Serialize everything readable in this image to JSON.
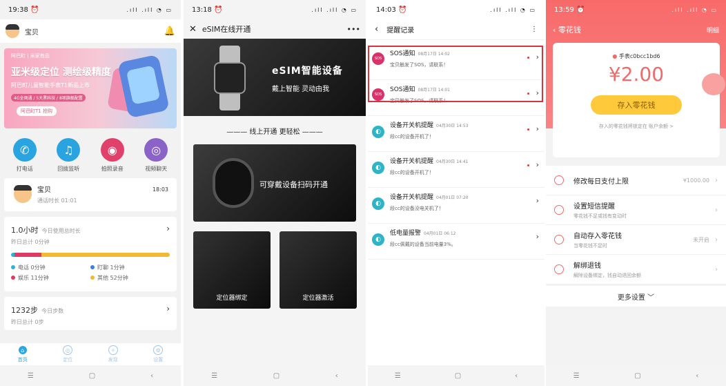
{
  "p1": {
    "time": "19:38 ⏰",
    "name": "宝贝",
    "banner": {
      "logo": "阿巴町 | 米家有品",
      "t1": "亚米级定位 测绘级精度",
      "t2": "阿巴町儿童智能手表T1新品上市",
      "t3": "4G全网通 / 5大黑科技 / 8项旗舰配置",
      "pill": "阿巴町T1 抢购"
    },
    "quick": [
      {
        "label": "打电话",
        "color": "#2aa4e0",
        "icon": "phone-icon",
        "glyph": "✆"
      },
      {
        "label": "回拨监听",
        "color": "#2aa4e0",
        "icon": "headphones-icon",
        "glyph": "♫"
      },
      {
        "label": "拍照录音",
        "color": "#e0406a",
        "icon": "camera-icon",
        "glyph": "◉"
      },
      {
        "label": "视频聊天",
        "color": "#8a62c8",
        "icon": "video-icon",
        "glyph": "◎"
      }
    ],
    "call": {
      "name": "宝贝",
      "time": "18:03",
      "sub": "通话时长 01:01"
    },
    "usage": {
      "big": "1.0小时",
      "small": "今日使用总时长",
      "sub": "昨日总计 0分钟",
      "segments": [
        {
          "color": "#2bb4d8",
          "frac": 0.02
        },
        {
          "color": "#e03a64",
          "frac": 0.17
        },
        {
          "color": "#f2b933",
          "frac": 0.81
        }
      ],
      "legend": [
        {
          "label": "电话 0分钟",
          "color": "#2bb4d8"
        },
        {
          "label": "盯聊 1分钟",
          "color": "#3b7de0"
        },
        {
          "label": "娱乐 11分钟",
          "color": "#e03a64"
        },
        {
          "label": "其他 52分钟",
          "color": "#f2b933"
        }
      ]
    },
    "steps": {
      "big": "1232步",
      "small": "今日步数",
      "sub": "昨日总计 0步"
    },
    "tabs": [
      "首页",
      "定位",
      "发现",
      "设置"
    ]
  },
  "p2": {
    "time": "13:18 ⏰",
    "title": "eSIM在线开通",
    "h1": "eSIM智能设备",
    "h2": "戴上智能 灵动由我",
    "div": "线上开通 更轻松",
    "scan": "可穿戴设备扫码开通",
    "b1": "定位器绑定",
    "b2": "定位器激活"
  },
  "p3": {
    "time": "14:03 ⏰",
    "title": "提醒记录",
    "rows": [
      {
        "t": "SOS通知",
        "tm": "08月17日 14:02",
        "m": "宝贝触发了SOS，请联系！",
        "type": "sos",
        "red": true
      },
      {
        "t": "SOS通知",
        "tm": "08月17日 14:01",
        "m": "宝贝触发了SOS，请联系！",
        "type": "sos",
        "red": true
      },
      {
        "t": "设备开关机提醒",
        "tm": "04月30日 14:53",
        "m": "段cc的设备开机了！",
        "type": "dev",
        "red": true
      },
      {
        "t": "设备开关机提醒",
        "tm": "04月30日 14:41",
        "m": "段cc的设备开机了！",
        "type": "dev",
        "red": true
      },
      {
        "t": "设备开关机提醒",
        "tm": "04月01日 07:20",
        "m": "段cc的设备没电关机了！",
        "type": "dev",
        "red": false
      },
      {
        "t": "低电量报警",
        "tm": "04月01日 06:12",
        "m": "段cc佩戴的设备当前电量3%。",
        "type": "dev",
        "red": false
      }
    ]
  },
  "p4": {
    "time": "13:59 ⏰",
    "title": "零花钱",
    "detail": "明细",
    "watch": "手表c0bcc1bd6",
    "amount": "¥2.00",
    "btn": "存入零花钱",
    "note": "存入的零花钱将锁定在 账户余额 >",
    "items": [
      {
        "a": "修改每日支付上限",
        "b": "",
        "v": "¥1000.00"
      },
      {
        "a": "设置短信提醒",
        "b": "零花钱不足或钱有变动时",
        "v": ""
      },
      {
        "a": "自动存入零花钱",
        "b": "当零花钱不足时",
        "v": "未开启"
      },
      {
        "a": "解绑退钱",
        "b": "解除设备绑定，钱自动退回余额",
        "v": ""
      }
    ],
    "more": "更多设置 ﹀"
  },
  "nav": [
    "☰",
    "▢",
    "‹"
  ]
}
